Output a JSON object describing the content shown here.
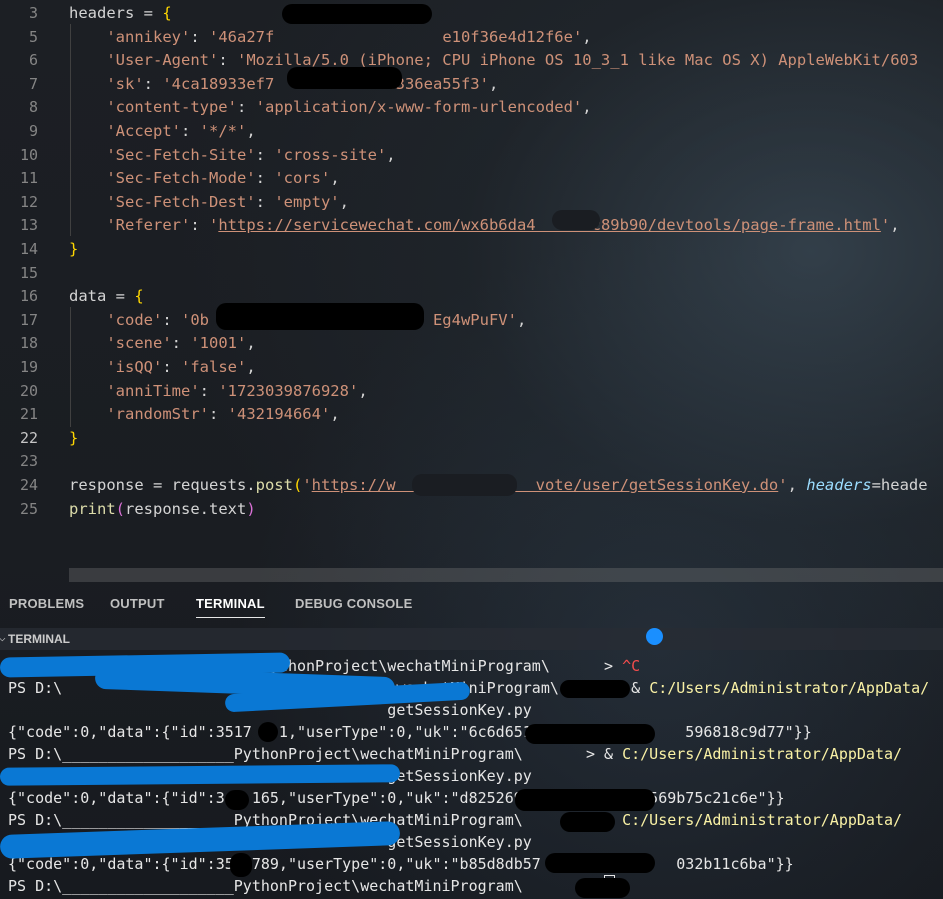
{
  "editor": {
    "lines": [
      {
        "num": "3",
        "parts": [
          [
            "k",
            "headers"
          ],
          [
            "k",
            " = "
          ],
          [
            "b",
            "{"
          ]
        ]
      },
      {
        "num": "5",
        "parts": [
          [
            "k",
            "    "
          ],
          [
            "s",
            "'annikey'"
          ],
          [
            "k",
            ": "
          ],
          [
            "s",
            "'46a27f"
          ],
          [
            "s",
            "                  "
          ],
          [
            "s",
            "e10f36e4d12f6e'"
          ],
          [
            "k",
            ","
          ]
        ]
      },
      {
        "num": "6",
        "parts": [
          [
            "k",
            "    "
          ],
          [
            "s",
            "'User-Agent'"
          ],
          [
            "k",
            ": "
          ],
          [
            "s",
            "'Mozilla/5.0 (iPhone; CPU iPhone OS 10_3_1 like Mac OS X) AppleWebKit/603"
          ]
        ]
      },
      {
        "num": "7",
        "parts": [
          [
            "k",
            "    "
          ],
          [
            "s",
            "'sk'"
          ],
          [
            "k",
            ": "
          ],
          [
            "s",
            "'4ca18933ef7"
          ],
          [
            "s",
            "            "
          ],
          [
            "s",
            "4336ea55f3'"
          ],
          [
            "k",
            ","
          ]
        ]
      },
      {
        "num": "8",
        "parts": [
          [
            "k",
            "    "
          ],
          [
            "s",
            "'content-type'"
          ],
          [
            "k",
            ": "
          ],
          [
            "s",
            "'application/x-www-form-urlencoded'"
          ],
          [
            "k",
            ","
          ]
        ]
      },
      {
        "num": "9",
        "parts": [
          [
            "k",
            "    "
          ],
          [
            "s",
            "'Accept'"
          ],
          [
            "k",
            ": "
          ],
          [
            "s",
            "'*/*'"
          ],
          [
            "k",
            ","
          ]
        ]
      },
      {
        "num": "10",
        "parts": [
          [
            "k",
            "    "
          ],
          [
            "s",
            "'Sec-Fetch-Site'"
          ],
          [
            "k",
            ": "
          ],
          [
            "s",
            "'cross-site'"
          ],
          [
            "k",
            ","
          ]
        ]
      },
      {
        "num": "11",
        "parts": [
          [
            "k",
            "    "
          ],
          [
            "s",
            "'Sec-Fetch-Mode'"
          ],
          [
            "k",
            ": "
          ],
          [
            "s",
            "'cors'"
          ],
          [
            "k",
            ","
          ]
        ]
      },
      {
        "num": "12",
        "parts": [
          [
            "k",
            "    "
          ],
          [
            "s",
            "'Sec-Fetch-Dest'"
          ],
          [
            "k",
            ": "
          ],
          [
            "s",
            "'empty'"
          ],
          [
            "k",
            ","
          ]
        ]
      },
      {
        "num": "13",
        "parts": [
          [
            "k",
            "    "
          ],
          [
            "s",
            "'Referer'"
          ],
          [
            "k",
            ": "
          ],
          [
            "s",
            "'"
          ],
          [
            "su",
            "https://servicewechat.com/wx6b6da4     2c89b90/devtools/page-frame.html"
          ],
          [
            "s",
            "'"
          ],
          [
            "k",
            ","
          ]
        ]
      },
      {
        "num": "14",
        "parts": [
          [
            "b",
            "}"
          ]
        ]
      },
      {
        "num": "15",
        "parts": []
      },
      {
        "num": "16",
        "parts": [
          [
            "k",
            "data"
          ],
          [
            "k",
            " = "
          ],
          [
            "b",
            "{"
          ]
        ]
      },
      {
        "num": "17",
        "parts": [
          [
            "k",
            "    "
          ],
          [
            "s",
            "'code'"
          ],
          [
            "k",
            ": "
          ],
          [
            "s",
            "'0b"
          ],
          [
            "s",
            "                        "
          ],
          [
            "s",
            "Eg4wPuFV'"
          ],
          [
            "k",
            ","
          ]
        ]
      },
      {
        "num": "18",
        "parts": [
          [
            "k",
            "    "
          ],
          [
            "s",
            "'scene'"
          ],
          [
            "k",
            ": "
          ],
          [
            "s",
            "'1001'"
          ],
          [
            "k",
            ","
          ]
        ]
      },
      {
        "num": "19",
        "parts": [
          [
            "k",
            "    "
          ],
          [
            "s",
            "'isQQ'"
          ],
          [
            "k",
            ": "
          ],
          [
            "s",
            "'false'"
          ],
          [
            "k",
            ","
          ]
        ]
      },
      {
        "num": "20",
        "parts": [
          [
            "k",
            "    "
          ],
          [
            "s",
            "'anniTime'"
          ],
          [
            "k",
            ": "
          ],
          [
            "s",
            "'1723039876928'"
          ],
          [
            "k",
            ","
          ]
        ]
      },
      {
        "num": "21",
        "parts": [
          [
            "k",
            "    "
          ],
          [
            "s",
            "'randomStr'"
          ],
          [
            "k",
            ": "
          ],
          [
            "s",
            "'432194664'"
          ],
          [
            "k",
            ","
          ]
        ]
      },
      {
        "num": "22",
        "active": true,
        "parts": [
          [
            "b",
            "}"
          ]
        ]
      },
      {
        "num": "23",
        "parts": []
      },
      {
        "num": "24",
        "parts": [
          [
            "k",
            "response = requests."
          ],
          [
            "f",
            "post"
          ],
          [
            "b",
            "("
          ],
          [
            "s",
            "'"
          ],
          [
            "su",
            "https://w               vote/user/getSessionKey.do"
          ],
          [
            "s",
            "'"
          ],
          [
            "k",
            ", "
          ],
          [
            "it",
            "headers"
          ],
          [
            "k",
            "=heade"
          ]
        ]
      },
      {
        "num": "25",
        "parts": [
          [
            "f",
            "print"
          ],
          [
            "p",
            "("
          ],
          [
            "k",
            "response.text"
          ],
          [
            "p",
            ")"
          ]
        ]
      }
    ]
  },
  "panel": {
    "tabs": [
      "PROBLEMS",
      "OUTPUT",
      "TERMINAL",
      "DEBUG CONSOLE"
    ],
    "active_tab": "TERMINAL",
    "terminal_title": "TERMINAL"
  },
  "terminal": {
    "lines": [
      {
        "parts": [
          [
            "w",
            "                            PythonProject\\wechatMiniProgram\\      > "
          ],
          [
            "r",
            "^C"
          ]
        ]
      },
      {
        "parts": [
          [
            "w",
            "PS D:\\                       PythonProject\\wechatMiniProgram\\      > & "
          ],
          [
            "y",
            "C:/Users/Administrator/AppData/"
          ]
        ]
      },
      {
        "parts": [
          [
            "w",
            "                                          getSessionKey.py"
          ]
        ]
      },
      {
        "parts": [
          [
            "w",
            "{\"code\":0,\"data\":{\"id\":3517   1,\"userType\":0,\"uk\":\"6c6d651                 596818c9d77\"}}"
          ]
        ]
      },
      {
        "parts": [
          [
            "w",
            "PS D:\\___________________PythonProject\\wechatMiniProgram\\       > & "
          ],
          [
            "y",
            "C:/Users/Administrator/AppData/"
          ]
        ]
      },
      {
        "parts": [
          [
            "w",
            "                                          getSessionKey.py"
          ]
        ]
      },
      {
        "parts": [
          [
            "w",
            "{\"code\":0,\"data\":{\"id\":3   165,\"userType\":0,\"uk\":\"d825269           d57569b75c21c6e\"}}"
          ]
        ]
      },
      {
        "parts": [
          [
            "w",
            "PS D:\\___________________PythonProject\\wechatMiniProgram\\       > & "
          ],
          [
            "y",
            "C:/Users/Administrator/AppData/"
          ]
        ]
      },
      {
        "parts": [
          [
            "w",
            "                                          getSessionKey.py"
          ]
        ]
      },
      {
        "parts": [
          [
            "w",
            "{\"code\":0,\"data\":{\"id\":35  789,\"userType\":0,\"uk\":\"b85d8db57               032b11c6ba\"}}"
          ]
        ]
      },
      {
        "parts": [
          [
            "w",
            "PS D:\\___________________PythonProject\\wechatMiniProgram\\       > "
          ],
          [
            "cursor",
            ""
          ]
        ]
      }
    ]
  }
}
